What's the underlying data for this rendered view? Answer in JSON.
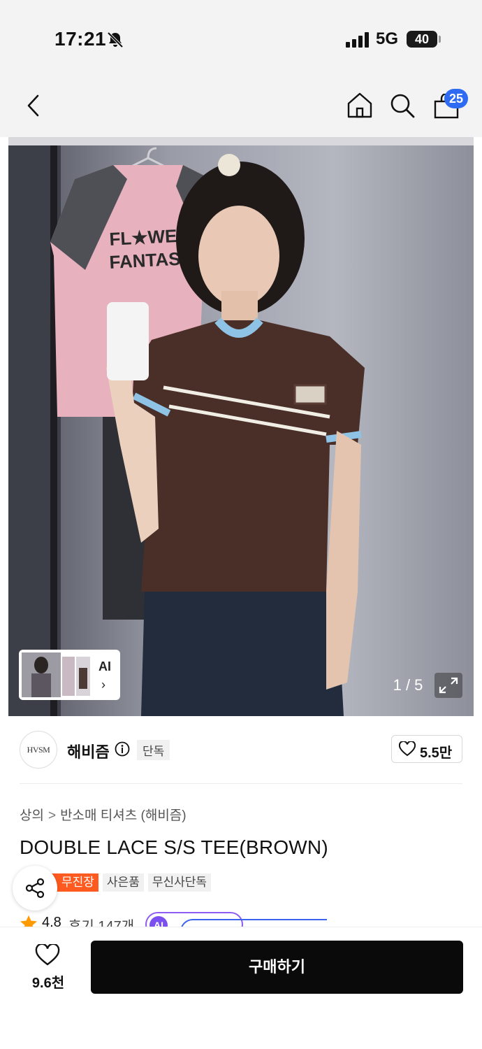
{
  "status_bar": {
    "time": "17:21",
    "network": "5G",
    "battery": "40",
    "icons": [
      "bell-slash-icon",
      "signal-icon",
      "battery-icon"
    ]
  },
  "nav": {
    "icons": [
      "back-icon",
      "home-icon",
      "search-icon",
      "cart-icon"
    ],
    "cart_badge": "25"
  },
  "hero": {
    "graphic_text": [
      "FL★WER",
      "FANTASY"
    ],
    "ai_label": "AI",
    "ai_chevron": "›",
    "counter": "1 / 5"
  },
  "brand": {
    "logo_text": "HVSM",
    "name": "해비즘",
    "tag": "단독",
    "likes": "5.5만"
  },
  "product": {
    "breadcrumb": [
      "상의",
      "반소매 티셔츠 (해비즘)"
    ],
    "breadcrumb_sep": ">",
    "title": "DOUBLE LACE S/S TEE(BROWN)",
    "tags": [
      "무진장",
      "사은품",
      "무신사단독"
    ],
    "rating": "4.8",
    "review": "후기 147개",
    "ai_pill_text": "AI"
  },
  "bottom": {
    "wish_count": "9.6천",
    "buy_label": "구매하기"
  },
  "colors": {
    "accent_blue": "#2f6bf2",
    "tag_orange": "#ff5a1f",
    "ai_purple": "#7b4ff0",
    "buy_black": "#0a0a0a",
    "star": "#ff9a00"
  }
}
